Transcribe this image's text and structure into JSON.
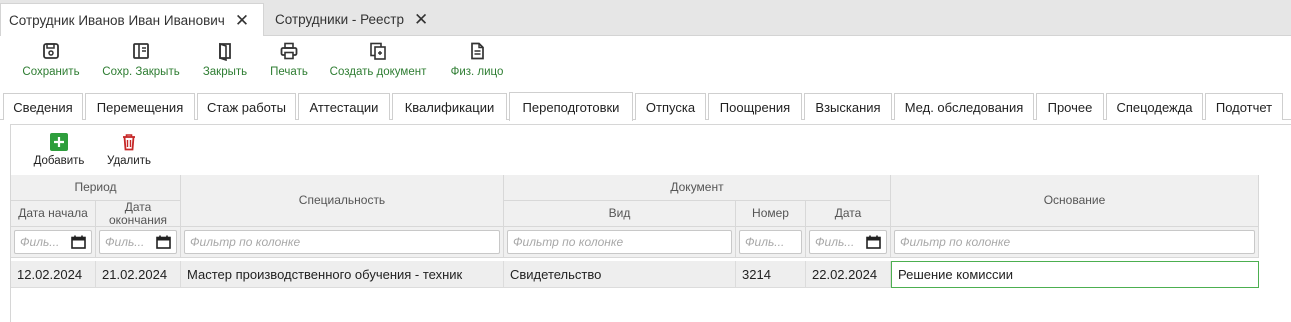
{
  "doc_tabs": [
    {
      "label": "Сотрудник Иванов Иван Иванович",
      "active": true
    },
    {
      "label": "Сотрудники - Реестр",
      "active": false
    }
  ],
  "close_glyph": "✕",
  "toolbar": {
    "save": "Сохранить",
    "save_close": "Сохр. Закрыть",
    "close": "Закрыть",
    "print": "Печать",
    "create_doc": "Создать документ",
    "person": "Физ. лицо"
  },
  "section_tabs": [
    "Сведения",
    "Перемещения",
    "Стаж работы",
    "Аттестации",
    "Квалификации",
    "Переподготовки",
    "Отпуска",
    "Поощрения",
    "Взыскания",
    "Мед. обследования",
    "Прочее",
    "Спецодежда",
    "Подотчет"
  ],
  "active_section": "Переподготовки",
  "actions": {
    "add": "Добавить",
    "delete": "Удалить"
  },
  "grid": {
    "group_period": "Период",
    "group_document": "Документ",
    "col_start": "Дата начала",
    "col_end": "Дата окончания",
    "col_specialty": "Специальность",
    "col_kind": "Вид",
    "col_number": "Номер",
    "col_date": "Дата",
    "col_basis": "Основание",
    "filter_placeholder": "Фильтр по колонке",
    "filter_short": "Филь..."
  },
  "rows": [
    {
      "start": "12.02.2024",
      "end": "21.02.2024",
      "specialty": "Мастер производственного обучения - техник",
      "kind": "Свидетельство",
      "number": "3214",
      "date": "22.02.2024",
      "basis": "Решение комиссии"
    }
  ],
  "colors": {
    "accent_green": "#2e7d32",
    "add_green": "#2e9e3c",
    "delete_red": "#c62828"
  }
}
